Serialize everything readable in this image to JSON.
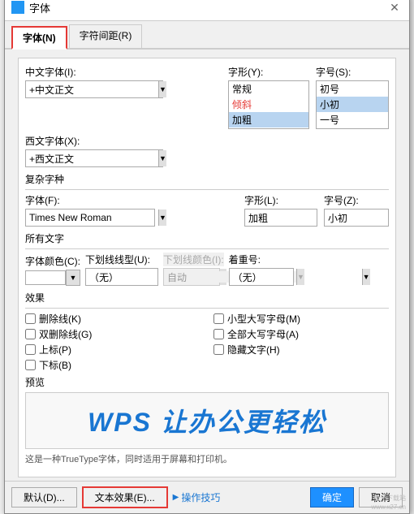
{
  "dialog": {
    "title": "字体",
    "close_label": "✕"
  },
  "tabs": [
    {
      "id": "font",
      "label": "字体(N)",
      "active": true
    },
    {
      "id": "spacing",
      "label": "字符间距(R)",
      "active": false
    }
  ],
  "chinese_font": {
    "label": "中文字体(I):",
    "value": "+中文正文",
    "options": [
      "+中文正文"
    ]
  },
  "style": {
    "label": "字形(Y):",
    "options_list": [
      "常规",
      "倾斜",
      "加粗"
    ],
    "selected": "加粗"
  },
  "size_zh": {
    "label": "字号(S):",
    "options_list": [
      "初号",
      "小初",
      "一号"
    ],
    "selected": "小初"
  },
  "western_font": {
    "label": "西文字体(X):",
    "value": "+西文正文",
    "options": [
      "+西文正文"
    ]
  },
  "complex_script": {
    "section": "复杂字种",
    "font_label": "字体(F):",
    "font_value": "Times New Roman",
    "style_label": "字形(L):",
    "style_value": "加粗",
    "size_label": "字号(Z):",
    "size_value": "小初"
  },
  "all_text": {
    "section": "所有文字",
    "color_label": "字体颜色(C):",
    "underline_label": "下划线线型(U):",
    "underline_value": "（无）",
    "underline_color_label": "下划线颜色(I):",
    "underline_color_value": "自动",
    "emphasis_label": "着重号:",
    "emphasis_value": "（无）"
  },
  "effects": {
    "section": "效果",
    "items_left": [
      {
        "id": "strikethrough",
        "label": "删除线(K)"
      },
      {
        "id": "double_strike",
        "label": "双删除线(G)"
      },
      {
        "id": "superscript",
        "label": "上标(P)"
      },
      {
        "id": "subscript",
        "label": "下标(B)"
      }
    ],
    "items_right": [
      {
        "id": "small_caps",
        "label": "小型大写字母(M)"
      },
      {
        "id": "all_caps",
        "label": "全部大写字母(A)"
      },
      {
        "id": "hidden",
        "label": "隐藏文字(H)"
      }
    ]
  },
  "preview": {
    "section": "预览",
    "text": "WPS 让办公更轻松"
  },
  "hint": "这是一种TrueType字体，同时适用于屏幕和打印机。",
  "footer": {
    "default_btn": "默认(D)...",
    "text_effect_btn": "文本效果(E)...",
    "help_icon": "▶",
    "help_label": "操作技巧",
    "ok_btn": "确定",
    "cancel_btn": "取消"
  },
  "watermark": "极光下载站\nwww.x27.cn"
}
